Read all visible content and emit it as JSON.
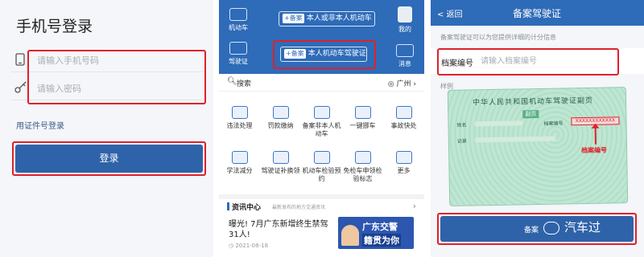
{
  "panel1": {
    "title": "手机号登录",
    "phone_placeholder": "请输入手机号码",
    "password_placeholder": "请输入密码",
    "alt_login": "用证件号登录",
    "login_button": "登录",
    "phone_icon": "phone-icon",
    "key_icon": "key-icon"
  },
  "panel2": {
    "side_left": [
      "机动车",
      "驾驶证"
    ],
    "side_right": [
      "我的",
      "消息"
    ],
    "pill_top": {
      "tag": "+备案",
      "label": "本人或非本人机动车"
    },
    "pill_mid": {
      "tag": "+备案",
      "label": "本人机动车驾驶证"
    },
    "search": {
      "label": "搜索",
      "location": "广州"
    },
    "grid": [
      [
        "违法处理",
        "罚款缴纳",
        "备案非本人机动车",
        "一键挪车",
        "事故快处"
      ],
      [
        "学法减分",
        "驾驶证补换领",
        "机动车检验预约",
        "免检车申领检验标志",
        "更多"
      ]
    ],
    "news": {
      "header": "资讯中心",
      "header_sub": "最新发布的地方交通资讯",
      "title": "曝光! 7月广东新增终生禁驾31人!",
      "date": "2021-08-18",
      "img_line1": "广东交警",
      "img_line2": "籍贯为你"
    }
  },
  "panel3": {
    "back": "< 返回",
    "title": "备案驾驶证",
    "hint": "备案驾驶证可以为您提供详细的计分信息",
    "field_label": "档案编号",
    "field_placeholder": "请输入档案编号",
    "sample_label": "样例",
    "card": {
      "title": "中华人民共和国机动车驾驶证副页",
      "sub": "副页",
      "name_key": "姓名",
      "file_key": "档案编号",
      "record_key": "记录",
      "xbox": "XXXXXXXXXXXX",
      "arrow_label": "档案编号"
    },
    "button_label": "备案",
    "watermark": "汽车过"
  },
  "colors": {
    "accent": "#2e6bb8",
    "highlight": "#e0202a"
  }
}
